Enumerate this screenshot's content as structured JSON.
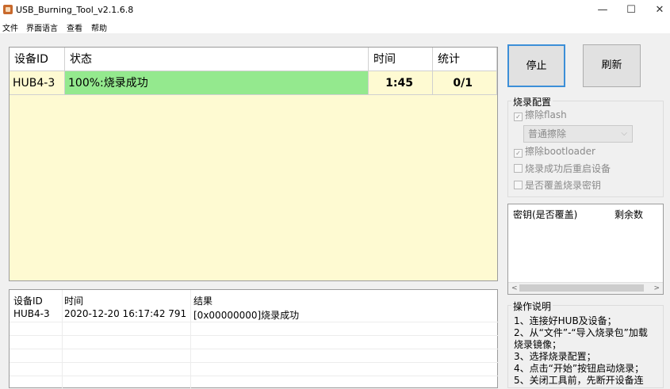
{
  "window": {
    "title": "USB_Burning_Tool_v2.1.6.8",
    "min_glyph": "—",
    "max_glyph": "☐",
    "close_glyph": "✕"
  },
  "menu": [
    "文件",
    "界面语言",
    "查看",
    "帮助"
  ],
  "device_table": {
    "headers": [
      "设备ID",
      "状态",
      "时间",
      "统计"
    ],
    "row": {
      "id": "HUB4-3",
      "status": "100%:烧录成功",
      "time": "1:45",
      "count": "0/1"
    }
  },
  "log_table": {
    "headers": [
      "设备ID",
      "时间",
      "结果"
    ],
    "rows": [
      {
        "id": "HUB4-3",
        "time": "2020-12-20 16:17:42 791",
        "result": "[0x00000000]烧录成功"
      }
    ]
  },
  "buttons": {
    "stop": "停止",
    "refresh": "刷新"
  },
  "config": {
    "title": "烧录配置",
    "erase_flash": {
      "label": "擦除flash",
      "checked": true
    },
    "erase_mode": "普通擦除",
    "erase_bootloader": {
      "label": "擦除bootloader",
      "checked": true
    },
    "reboot_after": {
      "label": "烧录成功后重启设备",
      "checked": false
    },
    "overwrite_key": {
      "label": "是否覆盖烧录密钥",
      "checked": false
    }
  },
  "key_list": {
    "headers": [
      "密钥(是否覆盖)",
      "剩余数"
    ]
  },
  "instructions": {
    "title": "操作说明",
    "lines": [
      "1、连接好HUB及设备；",
      "2、从“文件”-“导入烧录包”加载",
      "烧录镜像；",
      "3、选择烧录配置；",
      "4、点击“开始”按钮启动烧录；",
      "5、关闭工具前，先断开设备连"
    ]
  },
  "colors": {
    "success_green": "#94e98e",
    "table_bg": "#fefad2",
    "stop_focus": "#3c8fd8"
  },
  "icons": {
    "app": "app-icon",
    "check": "checkbox-icon",
    "dropdown": "chevron-down-icon"
  }
}
